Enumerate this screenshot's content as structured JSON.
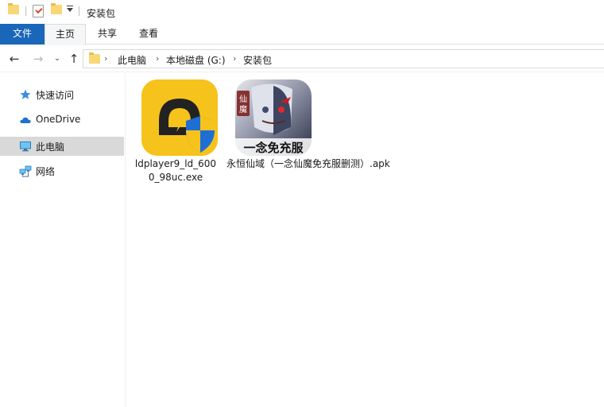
{
  "window": {
    "title": "安装包"
  },
  "ribbon": {
    "tabs": [
      {
        "label": "文件"
      },
      {
        "label": "主页"
      },
      {
        "label": "共享"
      },
      {
        "label": "查看"
      }
    ],
    "file_tab_color": "#1a66b8"
  },
  "address": {
    "crumbs": [
      "此电脑",
      "本地磁盘 (G:)",
      "安装包"
    ]
  },
  "sidebar": {
    "items": [
      {
        "label": "快速访问",
        "icon": "star-icon",
        "selected": false
      },
      {
        "label": "OneDrive",
        "icon": "cloud-icon",
        "selected": false
      },
      {
        "label": "此电脑",
        "icon": "computer-icon",
        "selected": true
      },
      {
        "label": "网络",
        "icon": "network-icon",
        "selected": false
      }
    ]
  },
  "files": [
    {
      "name": "ldplayer9_ld_6000_98uc.exe",
      "icon": "ldplayer-app-icon"
    },
    {
      "name": "永恒仙域（一念仙魔免充服删测）.apk",
      "icon": "game-apk-icon",
      "artwork_text": "一念免充服",
      "artwork_side_text": "仙魔"
    }
  ]
}
